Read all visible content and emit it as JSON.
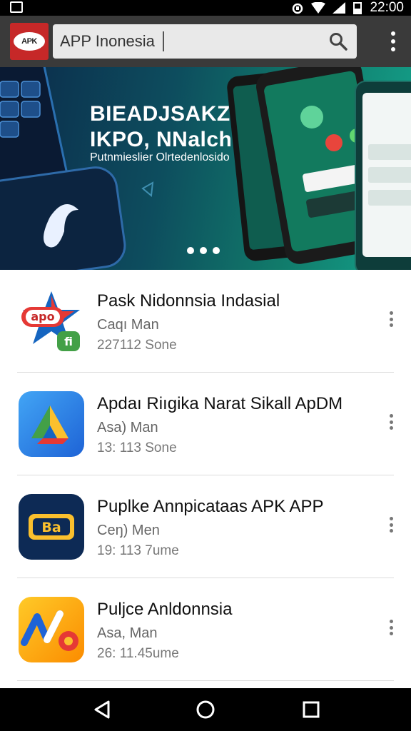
{
  "status_bar": {
    "time": "22:00"
  },
  "app_bar": {
    "logo_text": "APK",
    "search_value": "APP Inonesia"
  },
  "banner": {
    "title_line1": "BIEADJSAKZ",
    "title_line2": "IKPO, NNalch",
    "subtitle": "Putnmieslier Olrtedenlosido",
    "slide_count": 3
  },
  "apps": [
    {
      "title": "Pask Nidonnsia Indasial",
      "developer": "Caqı Man",
      "meta": "227112 Sone",
      "icon": "apk-star-icon"
    },
    {
      "title": "Apdaı Riıgika Narat Sikall ApDM",
      "developer": "Asa) Man",
      "meta": "13: 113 Sone",
      "icon": "triangle-play-icon"
    },
    {
      "title": "Puplke Annpicataas APK APP",
      "developer": "Ceŋ) Men",
      "meta": "19: 113 7ume",
      "icon": "ba-badge-icon"
    },
    {
      "title": "Puljce Anldonnsia",
      "developer": "Asa, Man",
      "meta": "26: 11.45ume",
      "icon": "v-logo-icon"
    }
  ],
  "colors": {
    "app_bar": "#3a3a3a",
    "banner_start": "#0c2a4a",
    "banner_end": "#14a38c"
  }
}
